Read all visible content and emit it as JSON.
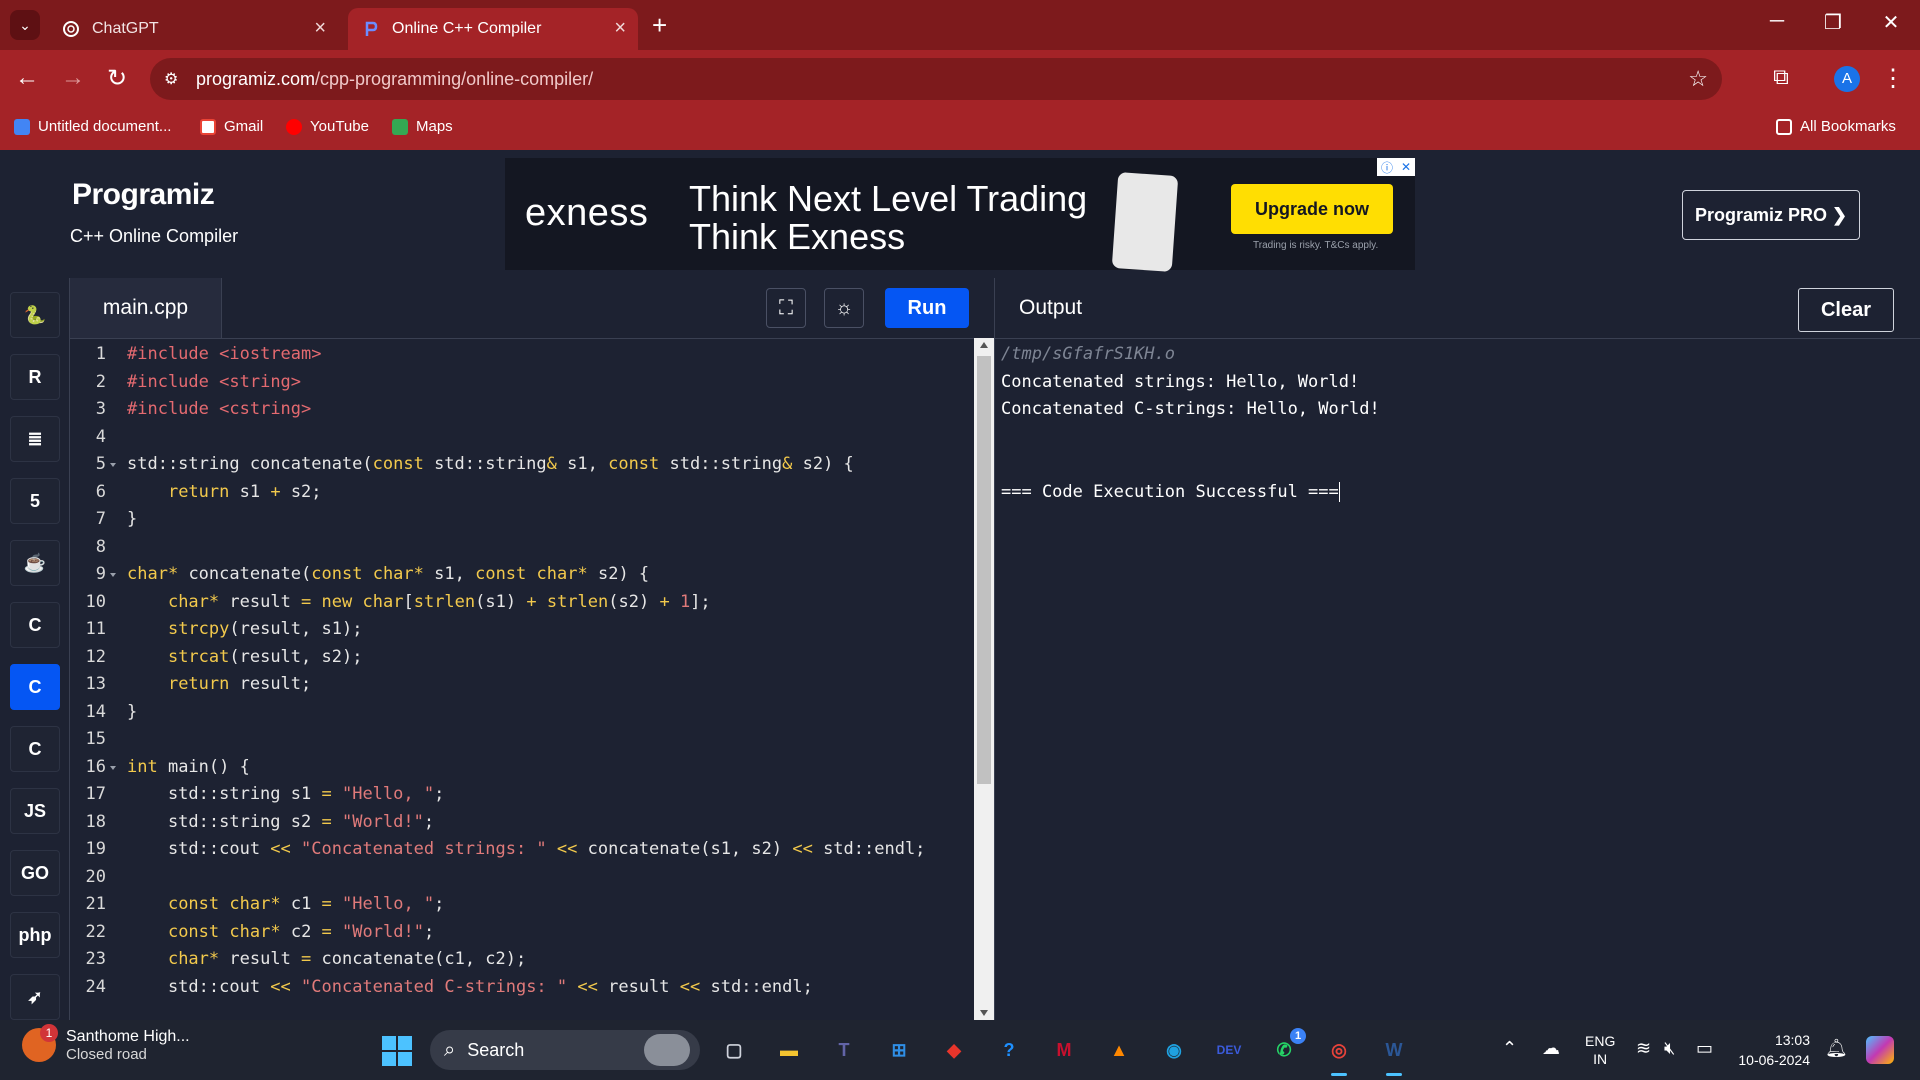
{
  "browser": {
    "tabs": [
      {
        "title": "ChatGPT",
        "active": false
      },
      {
        "title": "Online C++ Compiler",
        "active": true
      }
    ],
    "url_host": "programiz.com",
    "url_path": "/cpp-programming/online-compiler/",
    "profile_initial": "A",
    "bookmarks": [
      {
        "label": "Untitled document...",
        "icon": "docs-icon"
      },
      {
        "label": "Gmail",
        "icon": "gmail-icon"
      },
      {
        "label": "YouTube",
        "icon": "youtube-icon"
      },
      {
        "label": "Maps",
        "icon": "maps-icon"
      }
    ],
    "all_bookmarks": "All Bookmarks"
  },
  "site": {
    "logo": "Programiz",
    "subtitle": "C++ Online Compiler",
    "pro_button": "Programiz PRO ❯"
  },
  "ad": {
    "brand": "exness",
    "line1": "Think Next Level Trading",
    "line2": "Think Exness",
    "cta": "Upgrade now",
    "disclaimer": "Trading is risky. T&Cs apply."
  },
  "sidebar": {
    "languages": [
      {
        "name": "python-icon",
        "glyph": "🐍"
      },
      {
        "name": "r-icon",
        "glyph": "R"
      },
      {
        "name": "sql-icon",
        "glyph": "≣"
      },
      {
        "name": "html-icon",
        "glyph": "5"
      },
      {
        "name": "java-icon",
        "glyph": "☕"
      },
      {
        "name": "c-icon",
        "glyph": "C"
      },
      {
        "name": "cpp-icon",
        "glyph": "C",
        "active": true
      },
      {
        "name": "csharp-icon",
        "glyph": "C"
      },
      {
        "name": "js-icon",
        "glyph": "JS"
      },
      {
        "name": "go-icon",
        "glyph": "GO"
      },
      {
        "name": "php-icon",
        "glyph": "php"
      },
      {
        "name": "swift-icon",
        "glyph": "➶"
      }
    ]
  },
  "editor": {
    "filename": "main.cpp",
    "run_label": "Run",
    "lines": [
      "<span class=\"pp\">#include</span> <span class=\"pp\">&lt;iostream&gt;</span>",
      "<span class=\"pp\">#include</span> <span class=\"pp\">&lt;string&gt;</span>",
      "<span class=\"pp\">#include</span> <span class=\"pp\">&lt;cstring&gt;</span>",
      "",
      "std::string concatenate(<span class=\"kw\">const</span> std::string<span class=\"op\">&amp;</span> s1, <span class=\"kw\">const</span> std::string<span class=\"op\">&amp;</span> s2) {",
      "    <span class=\"kw\">return</span> s1 <span class=\"op\">+</span> s2;",
      "}",
      "",
      "<span class=\"kw\">char</span><span class=\"op\">*</span> concatenate(<span class=\"kw\">const</span> <span class=\"kw\">char</span><span class=\"op\">*</span> s1, <span class=\"kw\">const</span> <span class=\"kw\">char</span><span class=\"op\">*</span> s2) {",
      "    <span class=\"kw\">char</span><span class=\"op\">*</span> result <span class=\"op\">=</span> <span class=\"kw\">new</span> <span class=\"kw\">char</span>[<span class=\"kw\">strlen</span>(s1) <span class=\"op\">+</span> <span class=\"kw\">strlen</span>(s2) <span class=\"op\">+</span> <span class=\"num\">1</span>];",
      "    <span class=\"kw\">strcpy</span>(result, s1);",
      "    <span class=\"kw\">strcat</span>(result, s2);",
      "    <span class=\"kw\">return</span> result;",
      "}",
      "",
      "<span class=\"kw\">int</span> main() {",
      "    std::string s1 <span class=\"op\">=</span> <span class=\"str\">\"Hello, \"</span>;",
      "    std::string s2 <span class=\"op\">=</span> <span class=\"str\">\"World!\"</span>;",
      "    std::cout <span class=\"op\">&lt;&lt;</span> <span class=\"str\">\"Concatenated strings: \"</span> <span class=\"op\">&lt;&lt;</span> concatenate(s1, s2) <span class=\"op\">&lt;&lt;</span> std::endl;",
      "",
      "    <span class=\"kw\">const</span> <span class=\"kw\">char</span><span class=\"op\">*</span> c1 <span class=\"op\">=</span> <span class=\"str\">\"Hello, \"</span>;",
      "    <span class=\"kw\">const</span> <span class=\"kw\">char</span><span class=\"op\">*</span> c2 <span class=\"op\">=</span> <span class=\"str\">\"World!\"</span>;",
      "    <span class=\"kw\">char</span><span class=\"op\">*</span> result <span class=\"op\">=</span> concatenate(c1, c2);",
      "    std::cout <span class=\"op\">&lt;&lt;</span> <span class=\"str\">\"Concatenated C-strings: \"</span> <span class=\"op\">&lt;&lt;</span> result <span class=\"op\">&lt;&lt;</span> std::endl;"
    ],
    "fold_lines": [
      5,
      9,
      16
    ]
  },
  "output": {
    "title": "Output",
    "clear_label": "Clear",
    "path": "/tmp/sGfafrS1KH.o",
    "lines": [
      "Concatenated strings: Hello, World!",
      "Concatenated C-strings: Hello, World!",
      "",
      "",
      "=== Code Execution Successful ==="
    ]
  },
  "taskbar": {
    "weather_title": "Santhome High...",
    "weather_sub": "Closed road",
    "weather_badge": "1",
    "search_label": "Search",
    "apps": [
      {
        "name": "task-view-icon",
        "glyph": "▢",
        "color": "#cfd3dc"
      },
      {
        "name": "file-explorer-icon",
        "glyph": "▬",
        "color": "#f4c430"
      },
      {
        "name": "teams-icon",
        "glyph": "T",
        "color": "#6264a7"
      },
      {
        "name": "store-icon",
        "glyph": "⊞",
        "color": "#2f8fe6"
      },
      {
        "name": "app-red-icon",
        "glyph": "◆",
        "color": "#e8352b"
      },
      {
        "name": "help-icon",
        "glyph": "?",
        "color": "#1e90ff"
      },
      {
        "name": "mcafee-icon",
        "glyph": "M",
        "color": "#c8102e"
      },
      {
        "name": "vlc-icon",
        "glyph": "▲",
        "color": "#ff8800"
      },
      {
        "name": "edge-icon",
        "glyph": "◉",
        "color": "#1fa1e0"
      },
      {
        "name": "devhome-icon",
        "glyph": "DEV",
        "color": "#3b5bdb"
      },
      {
        "name": "whatsapp-icon",
        "glyph": "✆",
        "color": "#25d366",
        "badge": "1"
      },
      {
        "name": "chrome-icon",
        "glyph": "◎",
        "color": "#e8433a",
        "active": true
      },
      {
        "name": "word-icon",
        "glyph": "W",
        "color": "#2b5797",
        "active": true
      }
    ],
    "lang_top": "ENG",
    "lang_bottom": "IN",
    "time": "13:03",
    "date": "10-06-2024"
  }
}
